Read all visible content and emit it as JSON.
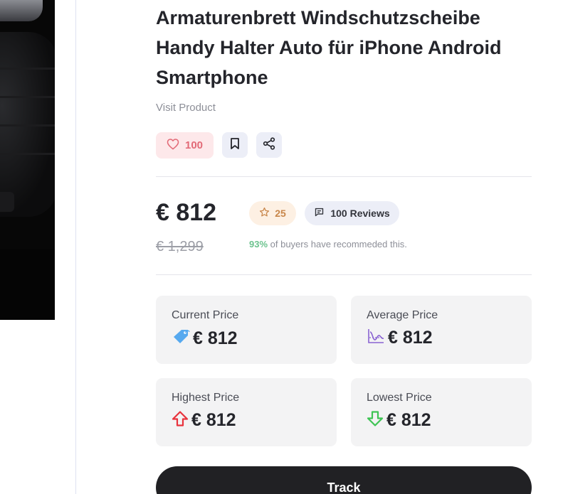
{
  "product": {
    "title": "Armaturenbrett Windschutzscheibe Handy Halter Auto für iPhone Android Smartphone",
    "visit_label": "Visit Product"
  },
  "actions": {
    "like_count": "100",
    "like_icon": "heart-icon",
    "bookmark_icon": "bookmark-icon",
    "share_icon": "share-icon"
  },
  "pricing": {
    "current": "€ 812",
    "original": "€ 1,299",
    "rating": "25",
    "reviews": "100 Reviews",
    "recommend_pct": "93%",
    "recommend_text": " of buyers have recommeded this."
  },
  "stats": [
    {
      "label": "Current Price",
      "value": "€ 812",
      "icon": "price-tag-icon"
    },
    {
      "label": "Average Price",
      "value": "€ 812",
      "icon": "average-chart-icon"
    },
    {
      "label": "Highest Price",
      "value": "€ 812",
      "icon": "arrow-up-icon"
    },
    {
      "label": "Lowest Price",
      "value": "€ 812",
      "icon": "arrow-down-icon"
    }
  ],
  "track_label": "Track",
  "colors": {
    "like_bg": "#fde8ea",
    "like_text": "#e26a77",
    "recommend_green": "#6cc38e",
    "track_bg": "#212124"
  }
}
